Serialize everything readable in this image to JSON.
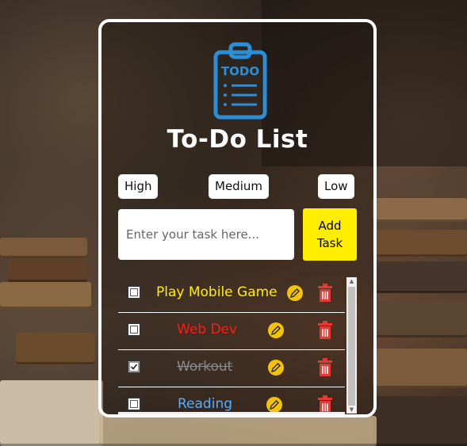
{
  "app": {
    "logo_text": "TODO",
    "title": "To-Do List"
  },
  "priority": {
    "high": "High",
    "medium": "Medium",
    "low": "Low"
  },
  "input": {
    "placeholder": "Enter your task here...",
    "value": ""
  },
  "add_button": "Add\nTask",
  "tasks": [
    {
      "text": "Play Mobile Game",
      "color": "#ffee00",
      "checked": false
    },
    {
      "text": "Web Dev",
      "color": "#ff1a1a",
      "checked": false
    },
    {
      "text": "Workout",
      "color": "#8a8a8a",
      "checked": true
    },
    {
      "text": "Reading",
      "color": "#5aaeff",
      "checked": false
    }
  ],
  "colors": {
    "accent": "#ffee00",
    "edit_icon": "#f5c400",
    "delete_icon": "#e53935",
    "logo_blue": "#2a8fd6"
  },
  "icons": {
    "logo": "clipboard-todo-icon",
    "edit": "pencil-icon",
    "delete": "trash-icon",
    "checkbox": "checkbox-icon"
  }
}
